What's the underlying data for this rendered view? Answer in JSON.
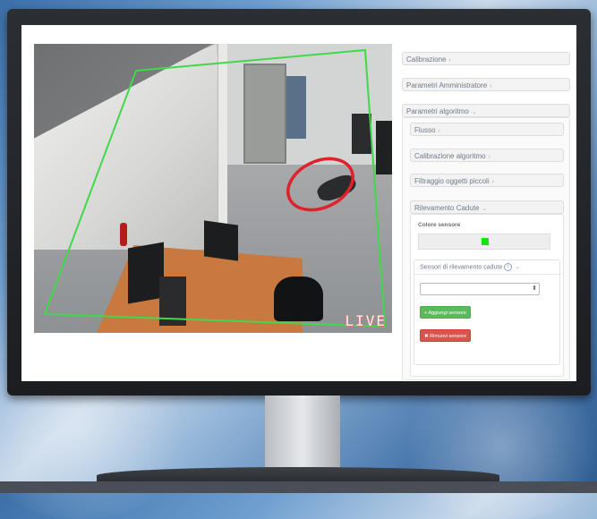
{
  "camera": {
    "overlay_text": "LIVE",
    "zone_color": "#3fd94a",
    "alert_color": "#e0202a"
  },
  "panel": {
    "sections": [
      {
        "label": "Calibrazione",
        "chevron": "›"
      },
      {
        "label": "Parametri Amministratore",
        "chevron": "›"
      },
      {
        "label": "Parametri algoritmo",
        "chevron": "⌄"
      }
    ],
    "algorithm_sections": [
      {
        "label": "Flusso",
        "chevron": "›"
      },
      {
        "label": "Calibrazione algoritmo",
        "chevron": "›"
      },
      {
        "label": "Filtraggio oggetti piccoli",
        "chevron": "›"
      },
      {
        "label": "Rilevamento Cadute",
        "chevron": "⌄"
      }
    ],
    "fall_detection": {
      "color_label": "Colore sensore",
      "sensor_color": "#14e014",
      "sensors_label": "Sensori di rilevamento cadute",
      "sensors_chevron": "⌄",
      "select_value": "",
      "add_button": "Aggiungi sensore",
      "remove_button": "Rimuovi sensore",
      "add_icon": "+",
      "remove_icon": "✖"
    }
  }
}
